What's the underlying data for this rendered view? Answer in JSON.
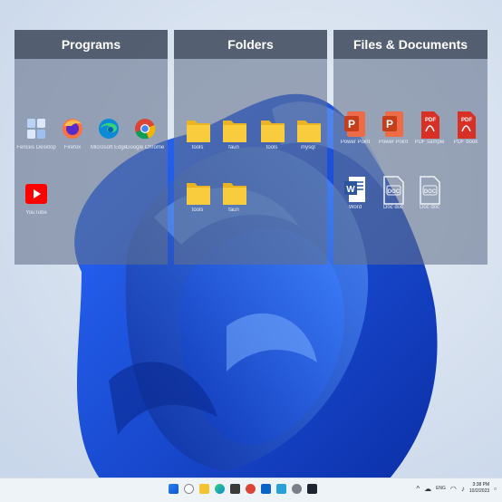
{
  "fences": {
    "programs": {
      "title": "Programs",
      "items": [
        {
          "label": "Fences Desktop",
          "icon": "fences-app-icon"
        },
        {
          "label": "Firefox",
          "icon": "firefox-icon"
        },
        {
          "label": "Microsoft Edge",
          "icon": "edge-icon"
        },
        {
          "label": "Google Chrome",
          "icon": "chrome-icon"
        },
        {
          "label": "YouTube",
          "icon": "youtube-icon"
        }
      ]
    },
    "folders": {
      "title": "Folders",
      "items": [
        {
          "label": "tools",
          "icon": "folder-icon"
        },
        {
          "label": "faun",
          "icon": "folder-icon"
        },
        {
          "label": "tools",
          "icon": "folder-icon"
        },
        {
          "label": "mysql",
          "icon": "folder-icon"
        },
        {
          "label": "tools",
          "icon": "folder-icon"
        },
        {
          "label": "faun",
          "icon": "folder-icon"
        }
      ]
    },
    "files": {
      "title": "Files & Documents",
      "items": [
        {
          "label": "Power Point",
          "icon": "powerpoint-icon"
        },
        {
          "label": "Power Point",
          "icon": "powerpoint-icon"
        },
        {
          "label": "PDF sample",
          "icon": "pdf-icon"
        },
        {
          "label": "PDF book",
          "icon": "pdf-icon"
        },
        {
          "label": "Word",
          "icon": "word-icon"
        },
        {
          "label": "Doc doc",
          "icon": "doc-icon"
        },
        {
          "label": "Doc doc",
          "icon": "doc-icon"
        }
      ]
    }
  },
  "taskbar": {
    "clock_time": "3:38 PM",
    "clock_date": "10/2/2023",
    "language": "ENG"
  },
  "colors": {
    "folder": "#f4c430",
    "powerpoint": "#d24726",
    "pdf": "#d93025",
    "word": "#2b579a",
    "youtube": "#ff0000",
    "wallpaper_blue": "#1a4fd6"
  }
}
